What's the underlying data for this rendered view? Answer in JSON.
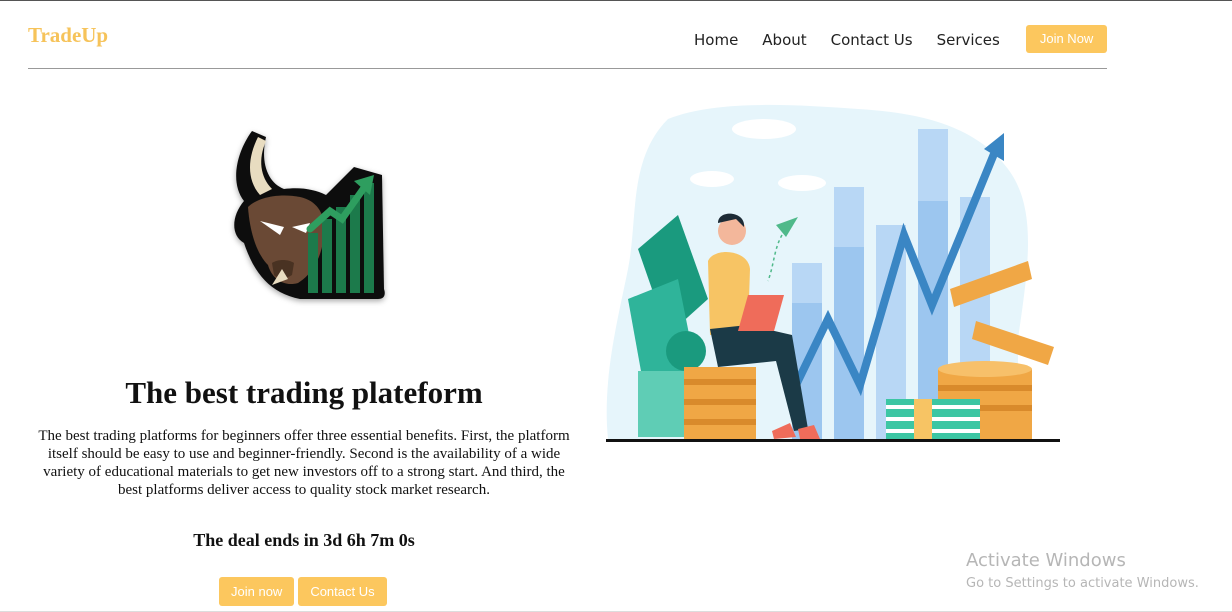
{
  "header": {
    "brand": "TradeUp",
    "nav": [
      "Home",
      "About",
      "Contact Us",
      "Services"
    ],
    "join_label": "Join Now"
  },
  "hero": {
    "headline": "The best trading plateform",
    "paragraph": "The best trading platforms for beginners offer three essential benefits. First, the platform itself should be easy to use and beginner-friendly. Second is the availability of a wide variety of educational materials to get new investors off to a strong start. And third, the best platforms deliver access to quality stock market research.",
    "deal_prefix": "The deal ends in",
    "deal_countdown": "3d 6h 7m 0s",
    "join_label": "Join now",
    "contact_label": "Contact Us"
  },
  "watermark": {
    "title": "Activate Windows",
    "subtitle": "Go to Settings to activate Windows."
  },
  "colors": {
    "accent": "#fcc75e",
    "brand": "#f6c35a"
  }
}
